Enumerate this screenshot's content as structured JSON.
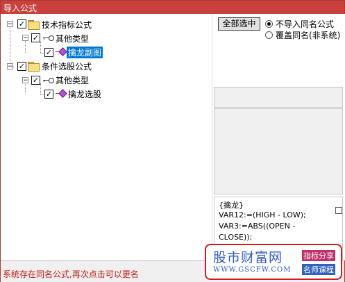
{
  "window": {
    "title": "导入公式"
  },
  "tree": {
    "nodes": [
      {
        "label": "技术指标公式",
        "checked": "✓",
        "expander": "−",
        "icon": "folder-icon"
      },
      {
        "label": "其他类型",
        "checked": "✓",
        "expander": "−",
        "icon": "key-icon"
      },
      {
        "label": "擒龙副图",
        "checked": "✓",
        "icon": "formula-diamond-icon",
        "selected": true
      },
      {
        "label": "条件选股公式",
        "checked": "✓",
        "expander": "−",
        "icon": "folder-icon"
      },
      {
        "label": "其他类型",
        "checked": "✓",
        "expander": "−",
        "icon": "key-icon"
      },
      {
        "label": "擒龙选股",
        "checked": "✓",
        "icon": "formula-diamond-icon"
      }
    ]
  },
  "options": {
    "select_all_label": "全部选中",
    "radio_skip_label": "不导入同名公式",
    "radio_overwrite_label": "覆盖同名(非系统)",
    "selected_radio": "skip"
  },
  "code_preview": {
    "lines": [
      "{擒龙}",
      "VAR12:=(HIGH - LOW);",
      "VAR3:=ABS((OPEN -",
      "CLOSE));"
    ]
  },
  "status": {
    "message": "系统存在同名公式,再次点击可以更名"
  },
  "watermark": {
    "brand": "股市财富网",
    "url": "WWW.GSCFW.COM",
    "tag1": "指标分享",
    "tag2": "名师课程"
  },
  "colors": {
    "titlebar": "#c9403c",
    "selection": "#0078d7",
    "status_text": "#c0181a",
    "watermark_blue": "#2f57c9"
  }
}
